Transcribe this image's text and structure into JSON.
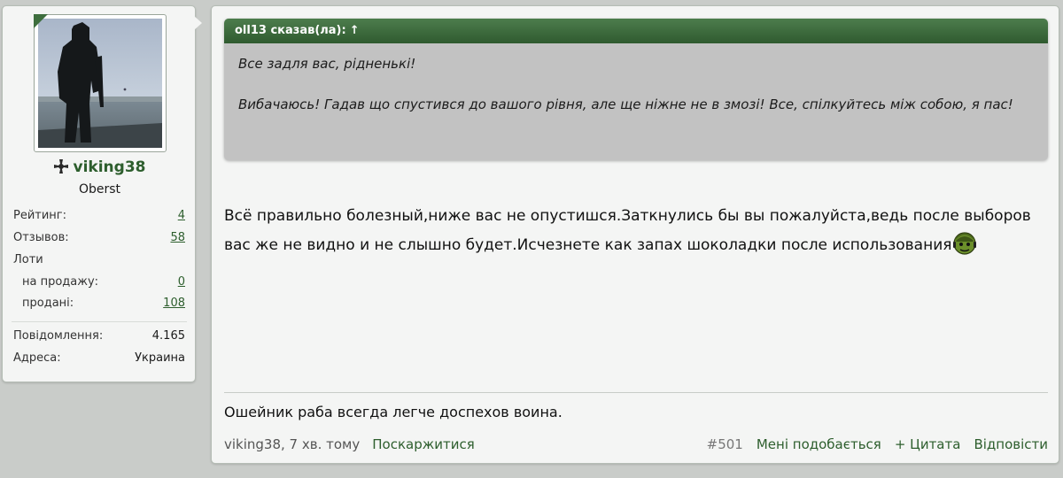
{
  "user": {
    "username": "viking38",
    "title": "Oberst",
    "stats": [
      {
        "label": "Рейтинг:",
        "value": "4"
      },
      {
        "label": "Отзывов:",
        "value": "58"
      }
    ],
    "lots_label": "Лоти",
    "lots": [
      {
        "label": "на продажу:",
        "value": "0"
      },
      {
        "label": "продані:",
        "value": "108"
      }
    ],
    "info": [
      {
        "label": "Повідомлення:",
        "value": "4.165"
      },
      {
        "label": "Адреса:",
        "value": "Украина"
      }
    ]
  },
  "quote": {
    "header": "oll13 сказав(ла):",
    "arrow": "↑",
    "lines": [
      "Все задля вас, рідненькі!",
      "Вибачаюсь! Гадав що спустився до вашого рівня, але ще ніжне не в змозі! Все, спілкуйтесь між собою, я пас!"
    ]
  },
  "message": {
    "text": "Всё правильно болезный,ниже вас не опустишся.Заткнулись бы вы пожалуйста,ведь после выборов вас же не видно и не слышно будет.Исчезнете как запах шоколадки после использования"
  },
  "signature": "Ошейник раба всегда легче доспехов воина.",
  "footer": {
    "author_time": "viking38, 7 хв. тому",
    "report": "Поскаржитися",
    "post_number": "#501",
    "like": "Мені подобається",
    "quote": "+ Цитата",
    "reply": "Відповісти"
  }
}
